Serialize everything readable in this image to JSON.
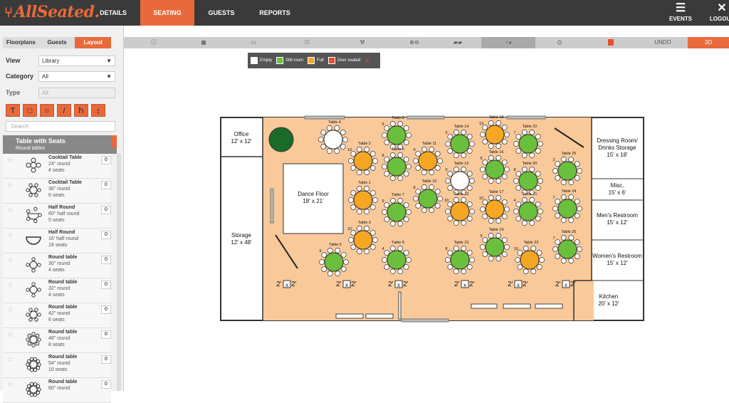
{
  "app": {
    "logo": "AllSeated.",
    "nav": [
      "DETAILS",
      "SEATING",
      "GUESTS",
      "REPORTS"
    ],
    "events_label": "EVENTS",
    "logout_label": "LOGOUT"
  },
  "sidebar": {
    "tabs": [
      "Floorplans",
      "Guests",
      "Layout"
    ],
    "view_label": "View",
    "view_value": "Library",
    "category_label": "Category",
    "category_value": "All",
    "type_label": "Type",
    "type_value": "All",
    "tool_icons": [
      "text-tool",
      "rectangle-tool",
      "ellipse-tool",
      "line-tool",
      "wall-tool",
      "dimension-tool"
    ],
    "search_placeholder": "Search",
    "category_title": "Table with Seats",
    "category_subtitle": "Round tables",
    "items": [
      {
        "name": "Cocktail Table",
        "size": "24\" round",
        "seats": "4 seats",
        "count": "0",
        "icon": "cocktail-24"
      },
      {
        "name": "Cocktail Table",
        "size": "36\" round",
        "seats": "6 seats",
        "count": "0",
        "icon": "cocktail-36"
      },
      {
        "name": "Half Round",
        "size": "60\" half round",
        "seats": "5 seats",
        "count": "0",
        "icon": "half-round-60"
      },
      {
        "name": "Half Round",
        "size": "16' half round",
        "seats": "18 seats",
        "count": "0",
        "icon": "half-round-16"
      },
      {
        "name": "Round table",
        "size": "30\" round",
        "seats": "4 seats",
        "count": "0",
        "icon": "round-30"
      },
      {
        "name": "Round table",
        "size": "32\" round",
        "seats": "4 seats",
        "count": "0",
        "icon": "round-32"
      },
      {
        "name": "Round table",
        "size": "42\" round",
        "seats": "6 seats",
        "count": "0",
        "icon": "round-42"
      },
      {
        "name": "Round table",
        "size": "48\" round",
        "seats": "8 seats",
        "count": "0",
        "icon": "round-48"
      },
      {
        "name": "Round table",
        "size": "54\" round",
        "seats": "10 seats",
        "count": "0",
        "icon": "round-54"
      },
      {
        "name": "Round table",
        "size": "60\" round",
        "seats": "",
        "count": "0",
        "icon": "round-60"
      }
    ]
  },
  "toolbar": {
    "icons": [
      "info-icon",
      "table-list-icon",
      "rectangle-icon",
      "grid-icon",
      "tool-icon",
      "zoom-icon",
      "number-icon",
      "color-icon",
      "print-icon",
      "pdf-icon"
    ],
    "info_glyph": "ⓘ",
    "zoom_glyph": "⊕⊖",
    "undo_label": "UNDO",
    "three_d_label": "3D"
  },
  "legend": {
    "items": [
      {
        "label": "Empty",
        "color": "#ffffff"
      },
      {
        "label": "Still room",
        "color": "#6abf3c"
      },
      {
        "label": "Full",
        "color": "#f5a623"
      },
      {
        "label": "Over seated",
        "color": "#e8502a"
      }
    ],
    "close": "✕"
  },
  "floorplan": {
    "rooms": {
      "office": [
        "Office",
        "12' x 12'"
      ],
      "storage": [
        "Storage",
        "12' x 48'"
      ],
      "dance": [
        "Dance Floor",
        "18' x 21'"
      ],
      "dressing": [
        "Dressing Room/",
        "Drinks Storage",
        "15' x 18'"
      ],
      "misc": [
        "Misc.",
        "15' x 6'"
      ],
      "mens": [
        "Men's Restroom",
        "15' x 12'"
      ],
      "womens": [
        "Women's Restroom",
        "15' x 12'"
      ],
      "kitchen": [
        "Kitchen",
        "20' x 12'"
      ]
    },
    "pillars": [
      "2'",
      "2'",
      "2'",
      "2'",
      "2'",
      "2'",
      "2'",
      "2'",
      "2'",
      "2'",
      "2'",
      "2'"
    ],
    "tables": [
      {
        "label": "Table 4",
        "num": "",
        "status": "empty"
      },
      {
        "label": "Table 8",
        "num": "9",
        "status": "still"
      },
      {
        "label": "Table 2",
        "num": "10",
        "status": "full"
      },
      {
        "label": "Table 6",
        "num": "8",
        "status": "still"
      },
      {
        "label": "Table 11",
        "num": "9",
        "status": "full"
      },
      {
        "label": "Table 1",
        "num": "",
        "status": "full"
      },
      {
        "label": "Table 10",
        "num": "8",
        "status": "still"
      },
      {
        "label": "Table 7",
        "num": "9",
        "status": "still"
      },
      {
        "label": "Table 3",
        "num": "10",
        "status": "full"
      },
      {
        "label": "Table 9",
        "num": "4",
        "status": "still"
      },
      {
        "label": "Table 5",
        "num": "9",
        "status": "still"
      },
      {
        "label": "Table 14",
        "num": "6",
        "status": "still"
      },
      {
        "label": "Table 12",
        "num": "0",
        "status": "empty"
      },
      {
        "label": "Table 13",
        "num": "10",
        "status": "full"
      },
      {
        "label": "Table 15",
        "num": "8",
        "status": "still"
      },
      {
        "label": "Table 18",
        "num": "10",
        "status": "full"
      },
      {
        "label": "Table 16",
        "num": "5",
        "status": "still"
      },
      {
        "label": "Table 17",
        "num": "10",
        "status": "full"
      },
      {
        "label": "Table 19",
        "num": "9",
        "status": "still"
      },
      {
        "label": "Table 22",
        "num": "7",
        "status": "still"
      },
      {
        "label": "Table 20",
        "num": "8",
        "status": "still"
      },
      {
        "label": "Table 21",
        "num": "4",
        "status": "still"
      },
      {
        "label": "Table 23",
        "num": "10",
        "status": "full"
      },
      {
        "label": "Table 25",
        "num": "2",
        "status": "still"
      },
      {
        "label": "Table 24",
        "num": "7",
        "status": "still"
      },
      {
        "label": "Table 26",
        "num": "7",
        "status": "still"
      }
    ]
  }
}
